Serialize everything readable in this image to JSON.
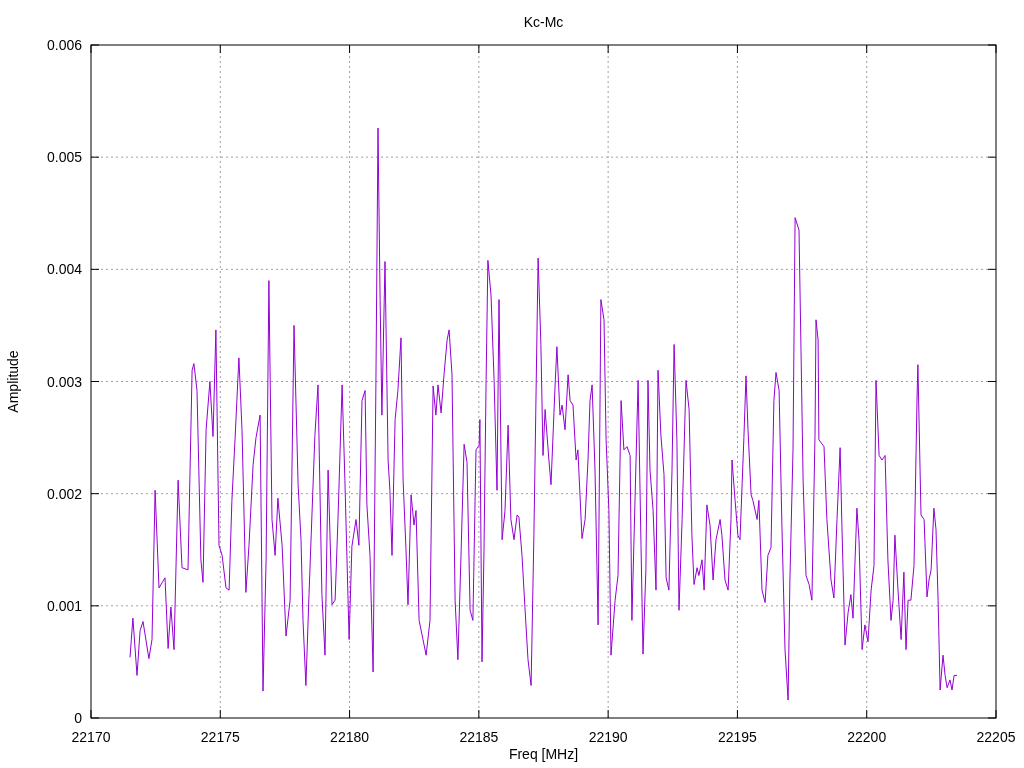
{
  "chart_data": {
    "type": "line",
    "title": "Kc-Mc",
    "xlabel": "Freq [MHz]",
    "ylabel": "Amplitude",
    "grid": true,
    "xlim": [
      22170,
      22205
    ],
    "ylim": [
      0,
      0.006
    ],
    "xticks": [
      22170,
      22175,
      22180,
      22185,
      22190,
      22195,
      22200,
      22205
    ],
    "yticks": [
      0,
      0.001,
      0.002,
      0.003,
      0.004,
      0.005,
      0.006
    ],
    "x": [
      22171.51,
      22171.62,
      22171.78,
      22171.9,
      22172.01,
      22172.24,
      22172.36,
      22172.48,
      22172.63,
      22172.86,
      22172.98,
      22173.09,
      22173.21,
      22173.37,
      22173.52,
      22173.75,
      22173.91,
      22173.98,
      22174.1,
      22174.25,
      22174.33,
      22174.45,
      22174.6,
      22174.72,
      22174.83,
      22174.95,
      22175.07,
      22175.22,
      22175.34,
      22175.45,
      22175.57,
      22175.72,
      22175.84,
      22175.99,
      22176.11,
      22176.27,
      22176.38,
      22176.54,
      22176.65,
      22176.77,
      22176.88,
      22177.0,
      22177.12,
      22177.23,
      22177.39,
      22177.54,
      22177.7,
      22177.85,
      22178.01,
      22178.12,
      22178.2,
      22178.31,
      22178.43,
      22178.66,
      22178.78,
      22178.93,
      22179.05,
      22179.17,
      22179.32,
      22179.44,
      22179.55,
      22179.71,
      22179.82,
      22179.98,
      22180.09,
      22180.25,
      22180.36,
      22180.48,
      22180.6,
      22180.67,
      22180.79,
      22180.91,
      22181.02,
      22181.1,
      22181.18,
      22181.25,
      22181.37,
      22181.49,
      22181.56,
      22181.64,
      22181.76,
      22181.87,
      22181.99,
      22182.07,
      22182.18,
      22182.26,
      22182.38,
      22182.49,
      22182.57,
      22182.69,
      22182.84,
      22182.96,
      22183.11,
      22183.23,
      22183.34,
      22183.42,
      22183.54,
      22183.65,
      22183.77,
      22183.85,
      22183.96,
      22184.08,
      22184.19,
      22184.31,
      22184.43,
      22184.54,
      22184.66,
      22184.77,
      22184.89,
      22185.01,
      22185.04,
      22185.12,
      22185.2,
      22185.28,
      22185.35,
      22185.47,
      22185.59,
      22185.7,
      22185.78,
      22185.9,
      22186.01,
      22186.13,
      22186.24,
      22186.36,
      22186.48,
      22186.55,
      22186.67,
      22186.79,
      22186.9,
      22187.02,
      22187.13,
      22187.29,
      22187.4,
      22187.48,
      22187.56,
      22187.71,
      22187.79,
      22187.95,
      22188.02,
      22188.14,
      22188.22,
      22188.33,
      22188.45,
      22188.53,
      22188.64,
      22188.76,
      22188.83,
      22188.99,
      22189.11,
      22189.22,
      22189.3,
      22189.38,
      22189.49,
      22189.61,
      22189.72,
      22189.84,
      22189.92,
      22190.03,
      22190.11,
      22190.27,
      22190.38,
      22190.5,
      22190.61,
      22190.73,
      22190.85,
      22190.92,
      22191.04,
      22191.16,
      22191.27,
      22191.35,
      22191.46,
      22191.54,
      22191.62,
      22191.74,
      22191.85,
      22191.93,
      22192.04,
      22192.16,
      22192.24,
      22192.35,
      22192.47,
      22192.55,
      22192.66,
      22192.74,
      22192.86,
      22193.01,
      22193.13,
      22193.24,
      22193.32,
      22193.44,
      22193.51,
      22193.63,
      22193.71,
      22193.82,
      22193.94,
      22194.06,
      22194.17,
      22194.33,
      22194.4,
      22194.52,
      22194.64,
      22194.75,
      22194.79,
      22194.91,
      22195.02,
      22195.1,
      22195.25,
      22195.33,
      22195.41,
      22195.53,
      22195.6,
      22195.76,
      22195.83,
      22195.95,
      22196.07,
      22196.18,
      22196.3,
      22196.41,
      22196.49,
      22196.61,
      22196.72,
      22196.84,
      22196.96,
      22197.03,
      22197.15,
      22197.23,
      22197.38,
      22197.46,
      22197.54,
      22197.65,
      22197.77,
      22197.88,
      22198.0,
      22198.04,
      22198.12,
      22198.15,
      22198.35,
      22198.46,
      22198.62,
      22198.73,
      22198.85,
      22198.97,
      22199.04,
      22199.16,
      22199.28,
      22199.39,
      22199.47,
      22199.62,
      22199.7,
      22199.82,
      22199.93,
      22200.05,
      22200.17,
      22200.28,
      22200.36,
      22200.48,
      22200.59,
      22200.71,
      22200.82,
      22200.94,
      22201.02,
      22201.09,
      22201.21,
      22201.33,
      22201.44,
      22201.52,
      22201.6,
      22201.71,
      22201.83,
      22201.95,
      22201.98,
      22202.1,
      22202.22,
      22202.33,
      22202.41,
      22202.49,
      22202.6,
      22202.68,
      22202.76,
      22202.84,
      22202.95,
      22203.03,
      22203.11,
      22203.22,
      22203.3,
      22203.38,
      22203.49
    ],
    "series": [
      {
        "color": "#9400d3",
        "values": [
          0.00054,
          0.00089,
          0.00038,
          0.00078,
          0.00086,
          0.00053,
          0.0007,
          0.00203,
          0.00116,
          0.00125,
          0.00062,
          0.00099,
          0.00061,
          0.00212,
          0.00134,
          0.00132,
          0.0031,
          0.00316,
          0.00292,
          0.00141,
          0.00121,
          0.00257,
          0.003,
          0.00251,
          0.00346,
          0.00154,
          0.00145,
          0.00116,
          0.00114,
          0.00194,
          0.00248,
          0.00321,
          0.00257,
          0.00112,
          0.00154,
          0.00226,
          0.0025,
          0.0027,
          0.00024,
          0.00141,
          0.0039,
          0.00177,
          0.00145,
          0.00196,
          0.00154,
          0.00073,
          0.00105,
          0.0035,
          0.00208,
          0.00159,
          0.00087,
          0.00029,
          0.0011,
          0.00252,
          0.00297,
          0.0011,
          0.00056,
          0.00221,
          0.00101,
          0.00105,
          0.00175,
          0.00297,
          0.00212,
          0.0007,
          0.00153,
          0.00177,
          0.00154,
          0.00283,
          0.00292,
          0.0019,
          0.00145,
          0.00041,
          0.00297,
          0.00526,
          0.00373,
          0.0027,
          0.00407,
          0.0023,
          0.00203,
          0.00145,
          0.00266,
          0.00292,
          0.00339,
          0.00212,
          0.00152,
          0.00101,
          0.00199,
          0.00172,
          0.00185,
          0.00087,
          0.0007,
          0.00056,
          0.00087,
          0.00296,
          0.0027,
          0.00297,
          0.00272,
          0.00306,
          0.00337,
          0.00346,
          0.00306,
          0.00105,
          0.00052,
          0.00145,
          0.00244,
          0.00228,
          0.00096,
          0.00087,
          0.00239,
          0.00243,
          0.00266,
          0.0005,
          0.0015,
          0.00301,
          0.00408,
          0.00377,
          0.00301,
          0.00203,
          0.00373,
          0.00159,
          0.00185,
          0.00261,
          0.00177,
          0.00159,
          0.00181,
          0.00179,
          0.00145,
          0.00096,
          0.00052,
          0.00029,
          0.00163,
          0.0041,
          0.00333,
          0.00234,
          0.00275,
          0.0023,
          0.00208,
          0.00297,
          0.00331,
          0.0027,
          0.00279,
          0.00257,
          0.00306,
          0.00283,
          0.00279,
          0.0023,
          0.00239,
          0.0016,
          0.00177,
          0.0023,
          0.00283,
          0.00297,
          0.00221,
          0.00083,
          0.00373,
          0.00355,
          0.00248,
          0.00185,
          0.00056,
          0.00105,
          0.00127,
          0.00283,
          0.00239,
          0.00242,
          0.00234,
          0.00087,
          0.00194,
          0.00301,
          0.00154,
          0.00057,
          0.00132,
          0.00301,
          0.00221,
          0.00185,
          0.00114,
          0.0031,
          0.00252,
          0.00217,
          0.00125,
          0.00114,
          0.00221,
          0.00333,
          0.00248,
          0.00096,
          0.00177,
          0.00301,
          0.00275,
          0.00163,
          0.00119,
          0.00134,
          0.00127,
          0.00141,
          0.00114,
          0.0019,
          0.00172,
          0.00123,
          0.00159,
          0.00177,
          0.00163,
          0.00123,
          0.00114,
          0.00177,
          0.0023,
          0.00194,
          0.00163,
          0.00159,
          0.0025,
          0.00305,
          0.00257,
          0.00199,
          0.00194,
          0.00177,
          0.00194,
          0.00114,
          0.00103,
          0.00145,
          0.00152,
          0.00283,
          0.00308,
          0.00292,
          0.00172,
          0.00061,
          0.00016,
          0.00123,
          0.00239,
          0.00446,
          0.00435,
          0.00328,
          0.00212,
          0.00127,
          0.00119,
          0.00105,
          0.00252,
          0.00355,
          0.00337,
          0.00248,
          0.00242,
          0.00177,
          0.00123,
          0.00107,
          0.00177,
          0.00241,
          0.00172,
          0.00065,
          0.00094,
          0.0011,
          0.00089,
          0.00187,
          0.00159,
          0.00061,
          0.00083,
          0.00068,
          0.00114,
          0.00136,
          0.00301,
          0.00234,
          0.0023,
          0.00234,
          0.00141,
          0.00087,
          0.00105,
          0.00163,
          0.00114,
          0.0007,
          0.0013,
          0.00061,
          0.00105,
          0.00105,
          0.00136,
          0.00288,
          0.00315,
          0.00181,
          0.00177,
          0.00108,
          0.00123,
          0.00132,
          0.00187,
          0.00168,
          0.00105,
          0.00025,
          0.00056,
          0.00038,
          0.00027,
          0.00034,
          0.00025,
          0.00038,
          0.00038
        ]
      }
    ]
  }
}
